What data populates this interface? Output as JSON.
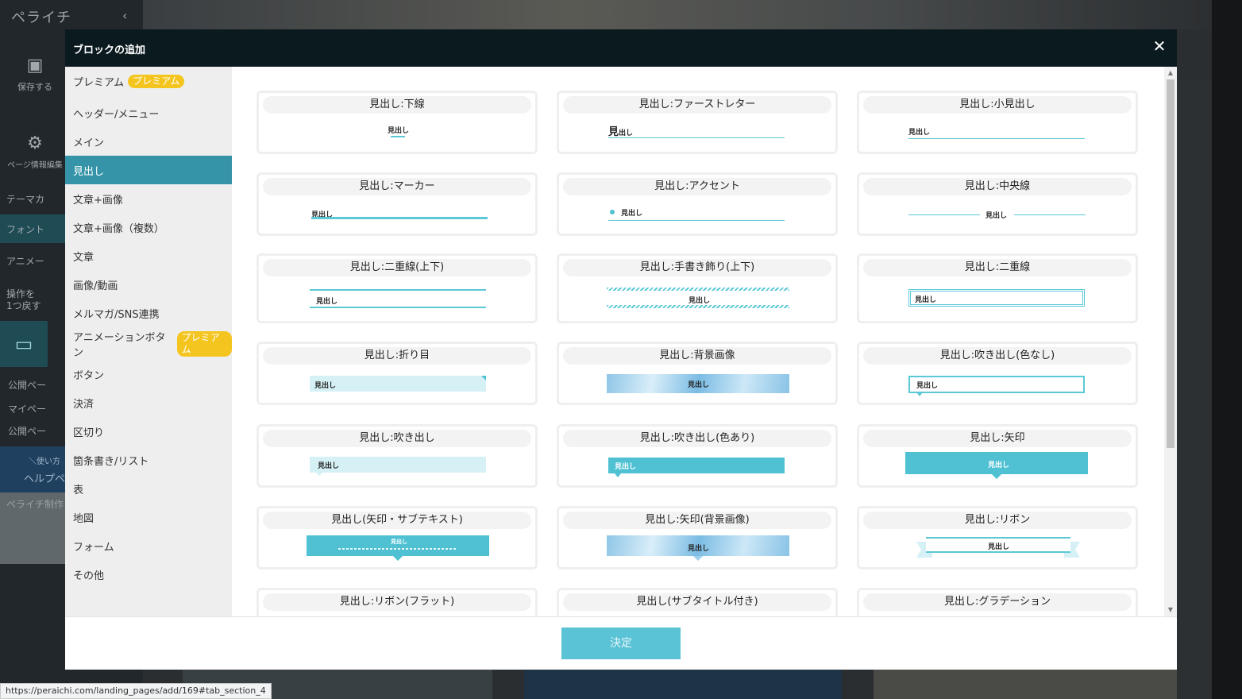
{
  "background": {
    "logo": "ペライチ",
    "save_label": "保存する",
    "page_info_label": "ページ情報編集",
    "rows": [
      "テーマカ",
      "フォント",
      "アニメー"
    ],
    "undo_label_1": "操作を",
    "undo_label_2": "1つ戻す",
    "links": [
      "公開ペー",
      "マイペー",
      "公開ペー"
    ],
    "help_small": "＼使い方",
    "help_label": "ヘルプペ",
    "profile_label": "ペライチ制作"
  },
  "modal": {
    "title": "ブロックの追加",
    "close_glyph": "✕",
    "premium_badge": "プレミアム",
    "categories": [
      {
        "label": "プレミアム",
        "premium": true
      },
      {
        "label": "ヘッダー/メニュー"
      },
      {
        "label": "メイン"
      },
      {
        "label": "見出し",
        "active": true
      },
      {
        "label": "文章+画像"
      },
      {
        "label": "文章+画像（複数）"
      },
      {
        "label": "文章"
      },
      {
        "label": "画像/動画"
      },
      {
        "label": "メルマガ/SNS連携"
      },
      {
        "label": "アニメーションボタン",
        "premium": true
      },
      {
        "label": "ボタン"
      },
      {
        "label": "決済"
      },
      {
        "label": "区切り"
      },
      {
        "label": "箇条書き/リスト"
      },
      {
        "label": "表"
      },
      {
        "label": "地図"
      },
      {
        "label": "フォーム"
      },
      {
        "label": "その他"
      }
    ],
    "preview_text": "見出し",
    "cards": [
      "見出し:下線",
      "見出し:ファーストレター",
      "見出し:小見出し",
      "見出し:マーカー",
      "見出し:アクセント",
      "見出し:中央線",
      "見出し:二重線(上下)",
      "見出し:手書き飾り(上下)",
      "見出し:二重線",
      "見出し:折り目",
      "見出し:背景画像",
      "見出し:吹き出し(色なし)",
      "見出し:吹き出し",
      "見出し:吹き出し(色あり)",
      "見出し:矢印",
      "見出し(矢印・サブテキスト)",
      "見出し:矢印(背景画像)",
      "見出し:リボン",
      "見出し:リボン(フラット)",
      "見出し(サブタイトル付き)",
      "見出し:グラデーション"
    ],
    "confirm_label": "決定"
  },
  "status_bar": {
    "url": "https://peraichi.com/landing_pages/add/169#tab_section_4"
  },
  "colors": {
    "accent": "#3594a8",
    "line": "#5bc8d6",
    "fill": "#4fc1d3",
    "light_fill": "#d5f1f5",
    "premium": "#f4c51f",
    "header": "#0b1a1f"
  }
}
